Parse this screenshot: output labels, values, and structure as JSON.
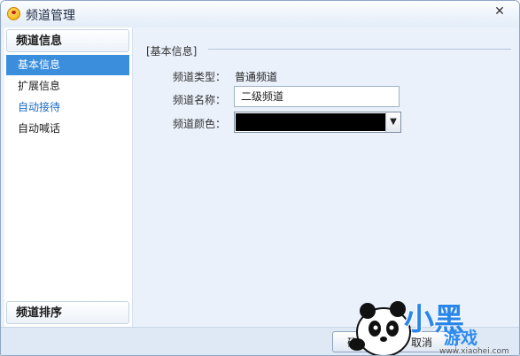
{
  "window": {
    "title": "频道管理",
    "close": "✕"
  },
  "sidebar": {
    "top_section": "频道信息",
    "items": [
      {
        "label": "基本信息"
      },
      {
        "label": "扩展信息"
      },
      {
        "label": "自动接待"
      },
      {
        "label": "自动喊话"
      }
    ],
    "bottom_section": "频道排序"
  },
  "main": {
    "group_title": "[基本信息]",
    "fields": {
      "type_label": "频道类型：",
      "type_value": "普通频道",
      "name_label": "频道名称：",
      "name_value": "二级频道",
      "color_label": "频道颜色：",
      "color_value": "#000000"
    }
  },
  "footer": {
    "ok_label": "确",
    "cancel_label": "取消"
  },
  "watermark": {
    "big": "小黑",
    "small": "游戏",
    "url": "www.xiaohei.com"
  },
  "colors": {
    "selected_bg": "#3b8edb",
    "link": "#1a6bc4",
    "window_bg": "#eaf1fb"
  }
}
